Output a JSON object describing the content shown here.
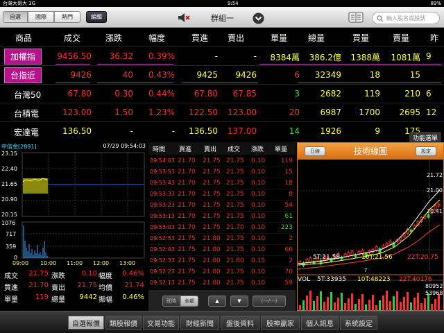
{
  "status": {
    "carrier": "台灣大哥大 3G",
    "time": "9:54",
    "battery": "89%"
  },
  "toolbar": {
    "tabs": [
      "自選",
      "國際",
      "熱門"
    ],
    "edit": "編輯",
    "group": "群組一",
    "search_placeholder": "輸入股名或股號"
  },
  "quote": {
    "headers": [
      "商品",
      "成交",
      "漲跌",
      "幅度",
      "買進",
      "賣出",
      "單量",
      "總量",
      "買量",
      "賣量",
      "昨"
    ],
    "rows": [
      {
        "name": "加權指",
        "price": "9456.50",
        "chg": "36.32",
        "pct": "0.39%",
        "bid": "-",
        "ask": "-",
        "vol": "8384萬",
        "total": "386.2億",
        "bidv": "1388萬",
        "askv": "1081萬",
        "extra": "9"
      },
      {
        "name": "台指近",
        "price": "9426",
        "chg": "40",
        "pct": "0.43%",
        "bid": "9425",
        "ask": "9426",
        "vol": "6",
        "total": "32349",
        "bidv": "18",
        "askv": "15",
        "extra": ""
      },
      {
        "name": "台灣50",
        "price": "67.80",
        "chg": "0.30",
        "pct": "0.44%",
        "bid": "67.80",
        "ask": "67.85",
        "vol": "3",
        "total": "2682",
        "bidv": "119",
        "askv": "210",
        "extra": "6"
      },
      {
        "name": "台積電",
        "price": "123.00",
        "chg": "1.50",
        "pct": "1.23%",
        "bid": "122.50",
        "ask": "123.00",
        "vol": "20",
        "total": "6987",
        "bidv": "1700",
        "askv": "2695",
        "extra": "12"
      },
      {
        "name": "宏達電",
        "price": "136.50",
        "chg": "-",
        "pct": "-",
        "bid": "136.50",
        "ask": "137.00",
        "vol": "14",
        "total": "1926",
        "bidv": "9",
        "askv": "175",
        "extra": ""
      }
    ],
    "func_label": "功能選單"
  },
  "mini": {
    "name": "中信金[2891]",
    "datetime": "07/29 09:54:03",
    "price_axis": [
      "23.15",
      "22.40",
      "21.65",
      "20.90",
      "20.15"
    ],
    "vol_axis": [
      "1076",
      "717",
      "359",
      "0"
    ],
    "time_axis": [
      "09:00",
      "10:00",
      "11:00",
      "12:00",
      "13:00"
    ],
    "stats": [
      {
        "l": "成交",
        "v": "21.75",
        "l2": "漲跌",
        "v2": "0.10",
        "l3": "幅度",
        "v3": "0.46%"
      },
      {
        "l": "買進",
        "v": "21.70",
        "l2": "賣出",
        "v2": "21.75",
        "l3": "均價",
        "v3": "21.74"
      },
      {
        "l": "單量",
        "v": "119",
        "l2": "總量",
        "v2": "9442",
        "l3": "振幅",
        "v3": "0.46%"
      }
    ]
  },
  "ticks": {
    "headers": [
      "時間",
      "買進",
      "賣出",
      "成交",
      "漲跌",
      "單量"
    ],
    "rows": [
      [
        "09:54:03",
        "21.70",
        "21.75",
        "21.75",
        "0.10",
        "119"
      ],
      [
        "09:53:53",
        "21.70",
        "21.75",
        "21.75",
        "0.10",
        "15"
      ],
      [
        "09:53:43",
        "21.70",
        "21.75",
        "21.75",
        "0.10",
        "18"
      ],
      [
        "09:53:33",
        "21.70",
        "21.75",
        "21.75",
        "0.10",
        "8"
      ],
      [
        "09:53:23",
        "21.70",
        "21.75",
        "21.75",
        "0.10",
        "54"
      ],
      [
        "09:53:13",
        "21.70",
        "21.75",
        "21.75",
        "0.10",
        "61"
      ],
      [
        "09:53:03",
        "21.70",
        "21.75",
        "21.70",
        "0.10",
        "223"
      ],
      [
        "09:52:53",
        "21.75",
        "21.80",
        "21.75",
        "0.10",
        "2"
      ],
      [
        "09:52:43",
        "21.75",
        "21.80",
        "21.75",
        "0.10",
        "66"
      ],
      [
        "09:52:33",
        "21.75",
        "21.80",
        "21.80",
        "0.15",
        "2"
      ],
      [
        "09:52:23",
        "21.75",
        "21.80",
        "21.75",
        "0.10",
        "70"
      ],
      [
        "09:52:13",
        "21.75",
        "21.80",
        "21.75",
        "0.10",
        "59"
      ]
    ],
    "tick_colors": [
      "red",
      "red",
      "red",
      "red",
      "red",
      "green",
      "green",
      "red",
      "red",
      "red",
      "red",
      "red"
    ],
    "foot": {
      "realtime": "即時",
      "all": "全部",
      "up": "▲",
      "down": "▼",
      "page": "(---/---)"
    }
  },
  "tech": {
    "title": "技術線圖",
    "day": "日線",
    "settings": "設定",
    "axis": [
      "21.72",
      "21.00",
      "20.41"
    ],
    "ma": [
      {
        "n": "5T:21.58",
        "c": "#ffffff"
      },
      {
        "n": "10T:21.56",
        "c": "#ffff40"
      },
      {
        "n": "22T:20.75",
        "c": "#ff4040"
      }
    ],
    "vol_labels": [
      {
        "n": "VOL",
        "c": "#ffffff"
      },
      {
        "n": "5T:33935",
        "c": "#ffffff"
      },
      {
        "n": "10T:48223",
        "c": "#ffff40"
      },
      {
        "n": "22T:40176",
        "c": "#ff4040"
      }
    ],
    "vol_axis": [
      "80952",
      "53968"
    ],
    "date_mark": "7"
  },
  "nav": {
    "tabs": [
      "自選報價",
      "類股報價",
      "交易功能",
      "財經新聞",
      "盤後資料",
      "股神贏家",
      "個人訊息",
      "系統設定"
    ]
  }
}
